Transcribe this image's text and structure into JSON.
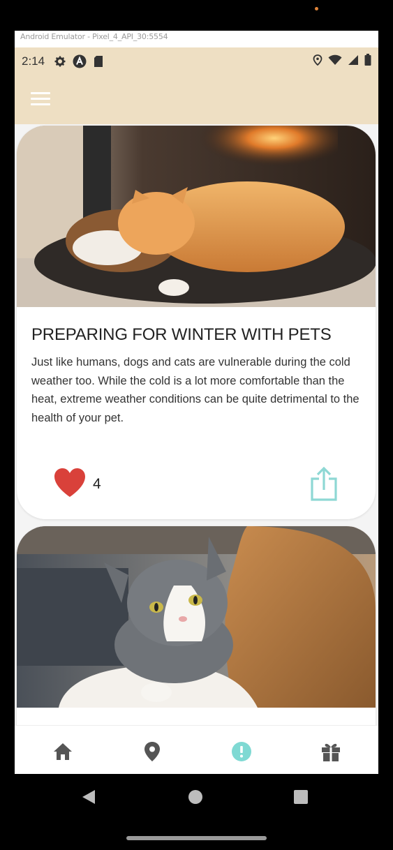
{
  "emulator": {
    "title": "Android Emulator - Pixel_4_API_30:5554"
  },
  "status_bar": {
    "time": "2:14",
    "left_icons": [
      "settings-icon",
      "a-circle-icon",
      "sd-card-icon"
    ],
    "right_icons": [
      "location-icon",
      "wifi-icon",
      "signal-icon",
      "battery-icon"
    ]
  },
  "app_bar": {
    "menu_icon": "hamburger-menu-icon",
    "background": "#eedfc3"
  },
  "posts": [
    {
      "image": "cat-and-dog-sleeping-by-fireplace",
      "title": "PREPARING FOR WINTER WITH PETS",
      "body": "Just like humans, dogs and cats are vulnerable during the cold weather too. While the cold is a lot more comfortable than the heat, extreme weather conditions can be quite detrimental to the health of your pet.",
      "likes": "4",
      "like_icon": "heart-icon",
      "share_icon": "share-icon"
    },
    {
      "image": "grey-white-cat-held-by-woman"
    }
  ],
  "bottom_nav": {
    "items": [
      {
        "icon": "home-icon",
        "active": false
      },
      {
        "icon": "location-pin-icon",
        "active": false
      },
      {
        "icon": "alert-icon",
        "active": true
      },
      {
        "icon": "gift-icon",
        "active": false
      }
    ],
    "active_color": "#7fd9d3",
    "inactive_color": "#555555"
  },
  "colors": {
    "heart": "#d9413a",
    "share": "#8ed8d4",
    "accent": "#eedfc3"
  }
}
